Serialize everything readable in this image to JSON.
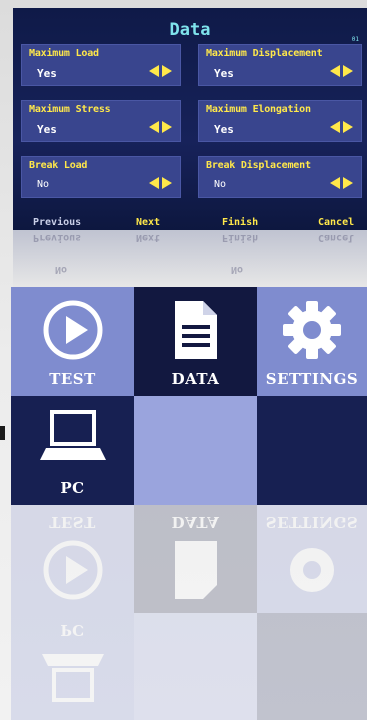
{
  "data_screen": {
    "title": "Data",
    "page": "01",
    "options": [
      {
        "label": "Maximum Load",
        "value": "Yes"
      },
      {
        "label": "Maximum Displacement",
        "value": "Yes"
      },
      {
        "label": "Maximum Stress",
        "value": "Yes"
      },
      {
        "label": "Maximum Elongation",
        "value": "Yes"
      },
      {
        "label": "Break Load",
        "value": "No"
      },
      {
        "label": "Break Displacement",
        "value": "No"
      }
    ],
    "nav": {
      "previous": "Previous",
      "next": "Next",
      "finish": "Finish",
      "cancel": "Cancel"
    }
  },
  "menu": {
    "test": "TEST",
    "data": "DATA",
    "settings": "SETTINGS",
    "pc": "PC"
  },
  "colors": {
    "screen_bg": "#17225a",
    "option_bg": "#39458e",
    "label_yellow": "#ffe84a",
    "title_cyan": "#7fe3ec",
    "tile_light": "#7f8ccf",
    "tile_dark": "#121840"
  }
}
